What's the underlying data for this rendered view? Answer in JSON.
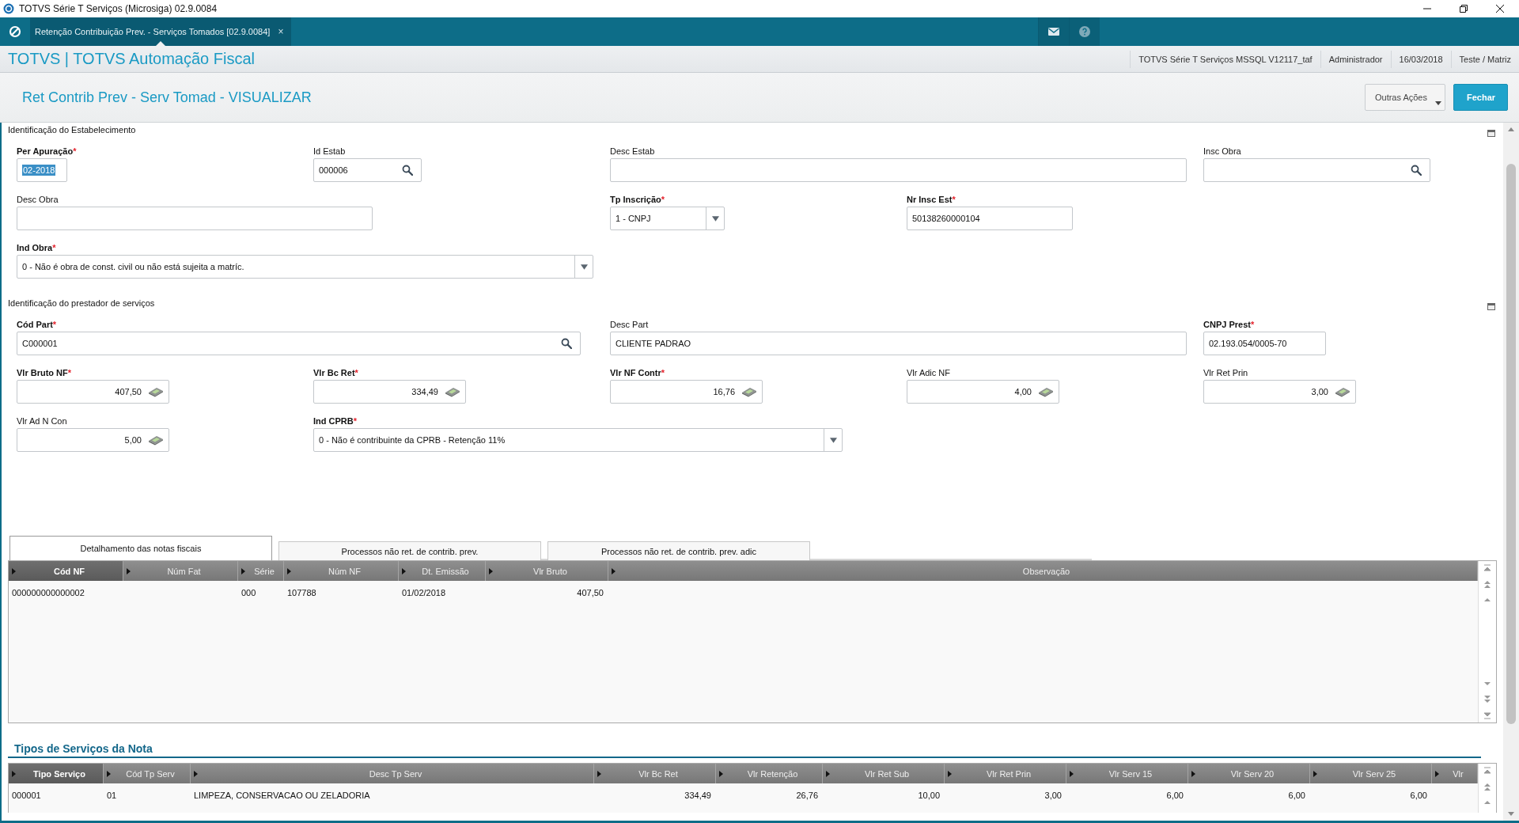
{
  "window": {
    "title": "TOTVS Série T Serviços (Microsiga) 02.9.0084"
  },
  "app_tabs": [
    {
      "label": "Retenção Contribuição Prev. - Serviços Tomados [02.9.0084]",
      "close": "×",
      "selected": true
    }
  ],
  "brand": "TOTVS | TOTVS Automação Fiscal",
  "session_info": [
    "TOTVS Série T Serviços MSSQL V12117_taf",
    "Administrador",
    "16/03/2018",
    "Teste / Matriz"
  ],
  "page_title": "Ret Contrib Prev - Serv Tomad - VISUALIZAR",
  "actions": [
    {
      "label": "Outras Ações",
      "kind": "menu"
    },
    {
      "label": "Fechar",
      "kind": "primary"
    }
  ],
  "sections": [
    {
      "title": "Identificação do Estabelecimento",
      "fields": [
        {
          "label": "Per Apuração",
          "required": true,
          "mark": "*",
          "kind": "text",
          "value": "02-2018",
          "value_selected": true
        },
        {
          "label": "Id Estab",
          "required": false,
          "kind": "lookup",
          "value": "000006"
        },
        {
          "label": "Desc Estab",
          "required": false,
          "kind": "text"
        },
        {
          "label": "Insc Obra",
          "required": false,
          "kind": "lookup"
        },
        {
          "label": "Desc Obra",
          "required": false,
          "kind": "text"
        },
        {
          "label": "Tp Inscrição",
          "required": true,
          "mark": "*",
          "kind": "select",
          "value": "1 - CNPJ"
        },
        {
          "label": "Nr Insc Est",
          "required": true,
          "mark": "*",
          "kind": "text",
          "value": "50138260000104"
        },
        {
          "label": "Ind Obra",
          "required": true,
          "mark": "*",
          "kind": "select",
          "value": "0 - Não é obra de const. civil ou não está sujeita a matríc."
        }
      ]
    },
    {
      "title": "Identificação do prestador de serviços",
      "fields": [
        {
          "label": "Cód Part",
          "required": true,
          "mark": "*",
          "kind": "lookup",
          "value": "C000001"
        },
        {
          "label": "Desc Part",
          "required": false,
          "kind": "text",
          "value": "CLIENTE PADRAO"
        },
        {
          "label": "CNPJ Prest",
          "required": true,
          "mark": "*",
          "kind": "text",
          "value": "02.193.054/0005-70"
        },
        {
          "label": "Vlr Bruto NF",
          "required": true,
          "mark": "*",
          "kind": "money",
          "value": "407,50"
        },
        {
          "label": "Vlr Bc Ret",
          "required": true,
          "mark": "*",
          "kind": "money",
          "value": "334,49"
        },
        {
          "label": "Vlr NF Contr",
          "required": true,
          "mark": "*",
          "kind": "money",
          "value": "16,76"
        },
        {
          "label": "Vlr Adic NF",
          "required": false,
          "kind": "money",
          "value": "4,00"
        },
        {
          "label": "Vlr Ret Prin",
          "required": false,
          "kind": "money",
          "value": "3,00"
        },
        {
          "label": "Vlr Ad N Con",
          "required": false,
          "kind": "money",
          "value": "5,00"
        },
        {
          "label": "Ind CPRB",
          "required": true,
          "mark": "*",
          "kind": "select",
          "value": "0 - Não é contribuinte da CPRB - Retenção 11%"
        }
      ]
    }
  ],
  "detail_tabs": [
    {
      "label": "Detalhamento das notas fiscais",
      "selected": true
    },
    {
      "label": "Processos não ret. de contrib. prev.",
      "selected": false
    },
    {
      "label": "Processos não ret. de contrib. prev. adic",
      "selected": false
    }
  ],
  "notes_table": {
    "columns": [
      {
        "label": "Cód NF",
        "selected": true
      },
      {
        "label": "Núm Fat",
        "selected": false
      },
      {
        "label": "Série",
        "selected": false
      },
      {
        "label": "Núm NF",
        "selected": false
      },
      {
        "label": "Dt. Emissão",
        "selected": false
      },
      {
        "label": "Vlr Bruto",
        "selected": false
      },
      {
        "label": "Observação",
        "selected": false
      }
    ],
    "rows": [
      [
        "000000000000002",
        null,
        "000",
        "107788",
        "01/02/2018",
        "407,50",
        null
      ]
    ]
  },
  "services": {
    "title": "Tipos de Serviços da Nota",
    "columns": [
      {
        "label": "Tipo Serviço",
        "selected": true
      },
      {
        "label": "Cód Tp Serv",
        "selected": false
      },
      {
        "label": "Desc Tp Serv",
        "selected": false
      },
      {
        "label": "Vlr Bc Ret",
        "selected": false
      },
      {
        "label": "Vlr Retenção",
        "selected": false
      },
      {
        "label": "Vlr Ret Sub",
        "selected": false
      },
      {
        "label": "Vlr Ret Prin",
        "selected": false
      },
      {
        "label": "Vlr Serv 15",
        "selected": false
      },
      {
        "label": "Vlr Serv 20",
        "selected": false
      },
      {
        "label": "Vlr Serv 25",
        "selected": false
      },
      {
        "label": "Vlr",
        "selected": false
      }
    ],
    "rows": [
      [
        "000001",
        "01",
        "LIMPEZA, CONSERVACAO OU ZELADORIA",
        "334,49",
        "26,76",
        "10,00",
        "3,00",
        "6,00",
        "6,00",
        "6,00",
        null
      ]
    ]
  }
}
